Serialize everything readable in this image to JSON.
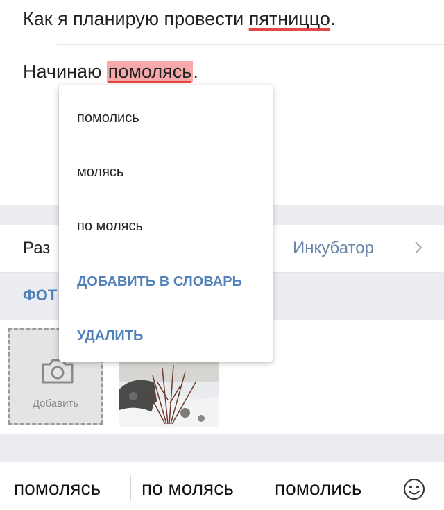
{
  "editor": {
    "line1_prefix": "Как я планирую провести ",
    "line1_misspelled": "пятниццо",
    "line1_suffix": ".",
    "line2_prefix": "Начинаю ",
    "line2_misspelled": "помолясь",
    "line2_suffix": "."
  },
  "section": {
    "label_visible": "Раз",
    "value": "Инкубатор",
    "chevron_icon": "chevron-right-icon"
  },
  "photos": {
    "header_visible": "ФОТ",
    "add_label": "Добавить",
    "add_icon": "camera-icon"
  },
  "popup": {
    "suggestions": [
      "помолись",
      "молясь",
      "по молясь"
    ],
    "add_to_dictionary": "ДОБАВИТЬ В СЛОВАРЬ",
    "delete": "УДАЛИТЬ"
  },
  "keyboard_suggestions": {
    "items": [
      "помолясь",
      "по молясь",
      "помолись"
    ],
    "emoji_icon": "emoji-icon"
  },
  "colors": {
    "accent": "#5181b8",
    "section_value": "#6a87ab",
    "spell_underline": "#e64646",
    "highlight": "#f5a9ab",
    "background_gray": "#ebedf0"
  }
}
